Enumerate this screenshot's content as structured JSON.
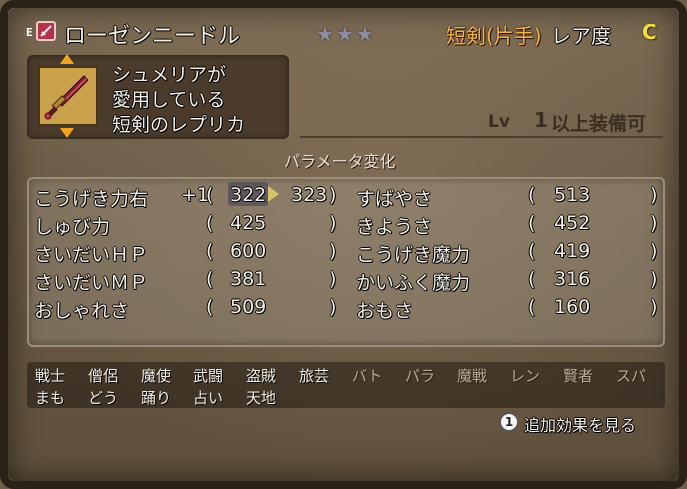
{
  "header": {
    "equip_mark": "E",
    "item_name": "ローゼンニードル",
    "stars": "★★★",
    "type": "短剣(片手)",
    "rarity_label": "レア度",
    "rarity_value": "C"
  },
  "description": {
    "lines": [
      "シュメリアが",
      "愛用している",
      "短剣のレプリカ"
    ]
  },
  "level": {
    "label": "Lv",
    "value": "1",
    "suffix": "以上装備可"
  },
  "params": {
    "title": "パラメータ変化",
    "left": [
      {
        "name": "こうげき力右",
        "delta": "+1",
        "value": "322",
        "new_value": "323"
      },
      {
        "name": "しゅび力",
        "value": "425"
      },
      {
        "name": "さいだいＨＰ",
        "value": "600"
      },
      {
        "name": "さいだいＭＰ",
        "value": "381"
      },
      {
        "name": "おしゃれさ",
        "value": "509"
      }
    ],
    "right": [
      {
        "name": "すばやさ",
        "value": "513"
      },
      {
        "name": "きようさ",
        "value": "452"
      },
      {
        "name": "こうげき魔力",
        "value": "419"
      },
      {
        "name": "かいふく魔力",
        "value": "316"
      },
      {
        "name": "おもさ",
        "value": "160"
      }
    ]
  },
  "jobs": {
    "row1": [
      {
        "label": "戦士",
        "on": true
      },
      {
        "label": "僧侶",
        "on": true
      },
      {
        "label": "魔使",
        "on": true
      },
      {
        "label": "武闘",
        "on": true
      },
      {
        "label": "盗賊",
        "on": true
      },
      {
        "label": "旅芸",
        "on": true
      },
      {
        "label": "バト",
        "on": false
      },
      {
        "label": "パラ",
        "on": false
      },
      {
        "label": "魔戦",
        "on": false
      },
      {
        "label": "レン",
        "on": false
      },
      {
        "label": "賢者",
        "on": false
      },
      {
        "label": "スパ",
        "on": false
      }
    ],
    "row2": [
      {
        "label": "まも",
        "on": true
      },
      {
        "label": "どう",
        "on": true
      },
      {
        "label": "踊り",
        "on": true
      },
      {
        "label": "占い",
        "on": true
      },
      {
        "label": "天地",
        "on": true
      }
    ]
  },
  "footer": {
    "button_number": "1",
    "button_label": "追加効果を見る"
  },
  "colors": {
    "type_text": "#f3b246",
    "rarity_value": "#f2e03a",
    "arrow": "#f2a320"
  }
}
